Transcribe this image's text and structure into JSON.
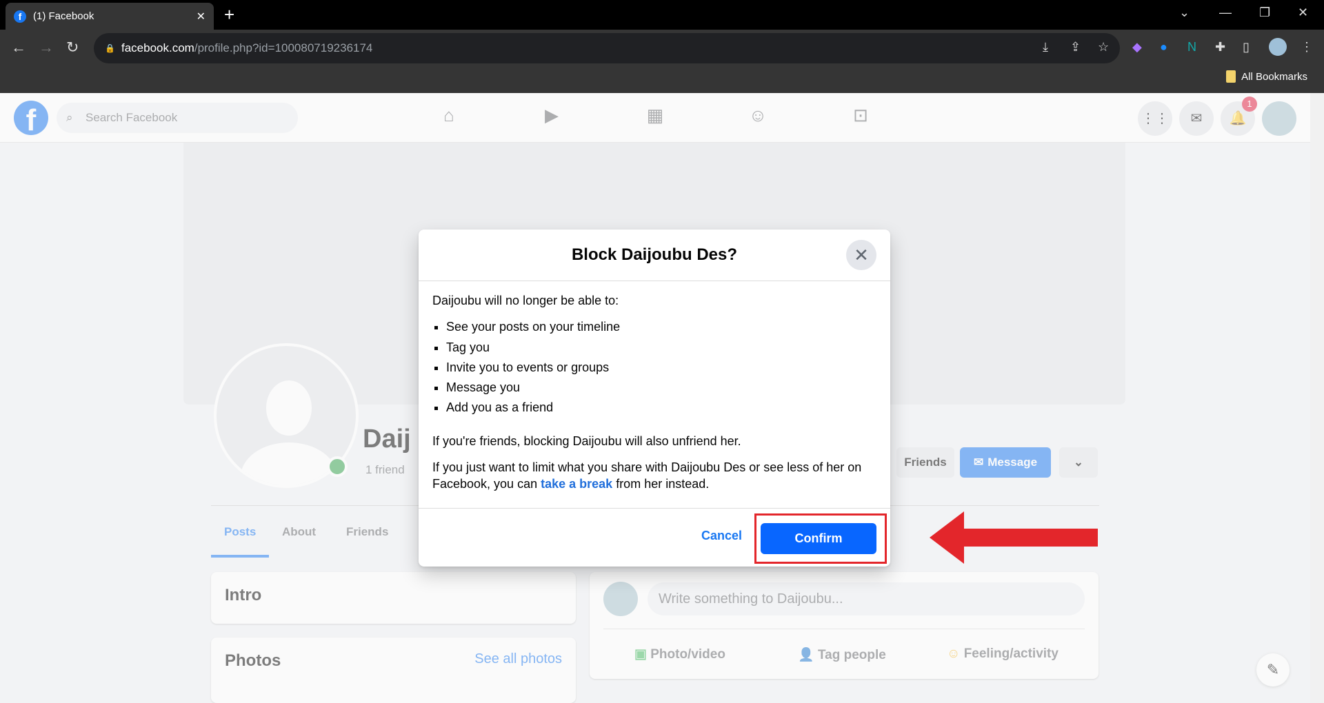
{
  "browser": {
    "tab_title": "(1) Facebook",
    "url_domain": "facebook.com",
    "url_path": "/profile.php?id=100080719236174",
    "bookmarks_label": "All Bookmarks"
  },
  "facebook": {
    "search_placeholder": "Search Facebook",
    "notification_count": "1"
  },
  "profile": {
    "name": "Daij",
    "friends": "1 friend",
    "friends_button": "Friends",
    "message_button": "Message",
    "tabs": [
      "Posts",
      "About",
      "Friends"
    ],
    "intro": "Intro",
    "photos": "Photos",
    "see_all_photos": "See all photos",
    "composer_placeholder": "Write something to Daijoubu...",
    "composer_actions": [
      "Photo/video",
      "Tag people",
      "Feeling/activity"
    ]
  },
  "dialog": {
    "title": "Block Daijoubu Des?",
    "intro": "Daijoubu will no longer be able to:",
    "items": [
      "See your posts on your timeline",
      "Tag you",
      "Invite you to events or groups",
      "Message you",
      "Add you as a friend"
    ],
    "unfriend_note": "If you're friends, blocking Daijoubu will also unfriend her.",
    "break_pre": "If you just want to limit what you share with Daijoubu Des or see less of her on Facebook, you can ",
    "break_link": "take a break",
    "break_post": " from her instead.",
    "cancel": "Cancel",
    "confirm": "Confirm"
  },
  "colors": {
    "accent": "#0866ff",
    "annotation": "#e3262b"
  }
}
